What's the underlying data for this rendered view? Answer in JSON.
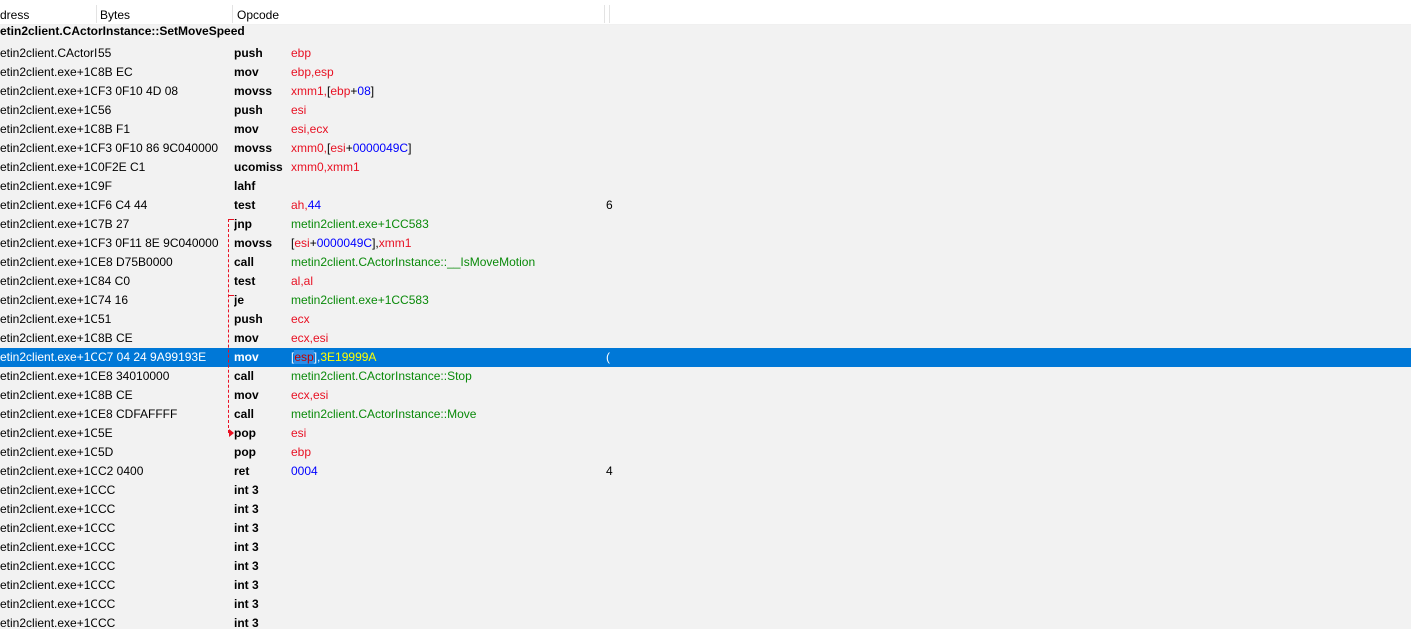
{
  "columns": {
    "address": "dress",
    "bytes": "Bytes",
    "opcode": "Opcode"
  },
  "function_label": "etin2client.CActorInstance::SetMoveSpeed",
  "colors": {
    "selection": "#0078d7",
    "register": "#e81123",
    "number": "#0000ff",
    "symbol": "#0a8a0a",
    "jump_line": "#e81123"
  },
  "rows": [
    {
      "address": "etin2client.CActorIn",
      "bytes": "55",
      "mnemonic": "push",
      "comment": "",
      "operands": [
        {
          "t": "ebp",
          "k": "reg"
        }
      ]
    },
    {
      "address": "etin2client.exe+1C",
      "bytes": "8B EC",
      "mnemonic": "mov",
      "comment": "",
      "operands": [
        {
          "t": "ebp,esp",
          "k": "reg"
        }
      ]
    },
    {
      "address": "etin2client.exe+1C",
      "bytes": "F3 0F10 4D 08",
      "mnemonic": "movss",
      "comment": "",
      "operands": [
        {
          "t": "xmm1,",
          "k": "reg"
        },
        {
          "t": "[",
          "k": "br"
        },
        {
          "t": "ebp",
          "k": "reg"
        },
        {
          "t": "+",
          "k": "br"
        },
        {
          "t": "08",
          "k": "num"
        },
        {
          "t": "]",
          "k": "br"
        }
      ]
    },
    {
      "address": "etin2client.exe+1C",
      "bytes": "56",
      "mnemonic": "push",
      "comment": "",
      "operands": [
        {
          "t": "esi",
          "k": "reg"
        }
      ]
    },
    {
      "address": "etin2client.exe+1C",
      "bytes": "8B F1",
      "mnemonic": "mov",
      "comment": "",
      "operands": [
        {
          "t": "esi,ecx",
          "k": "reg"
        }
      ]
    },
    {
      "address": "etin2client.exe+1C",
      "bytes": "F3 0F10 86 9C040000",
      "mnemonic": "movss",
      "comment": "",
      "operands": [
        {
          "t": "xmm0,",
          "k": "reg"
        },
        {
          "t": "[",
          "k": "br"
        },
        {
          "t": "esi",
          "k": "reg"
        },
        {
          "t": "+",
          "k": "br"
        },
        {
          "t": "0000049C",
          "k": "num"
        },
        {
          "t": "]",
          "k": "br"
        }
      ]
    },
    {
      "address": "etin2client.exe+1C",
      "bytes": "0F2E C1",
      "mnemonic": "ucomiss",
      "comment": "",
      "operands": [
        {
          "t": "xmm0,xmm1",
          "k": "reg"
        }
      ]
    },
    {
      "address": "etin2client.exe+1C",
      "bytes": "9F",
      "mnemonic": "lahf",
      "comment": "",
      "operands": []
    },
    {
      "address": "etin2client.exe+1C",
      "bytes": "F6 C4 44",
      "mnemonic": "test",
      "comment": "6",
      "operands": [
        {
          "t": "ah,",
          "k": "reg"
        },
        {
          "t": "44",
          "k": "num"
        }
      ]
    },
    {
      "address": "etin2client.exe+1C",
      "bytes": "7B 27",
      "mnemonic": "jnp",
      "comment": "",
      "operands": [
        {
          "t": "metin2client.exe+1CC583",
          "k": "addr"
        }
      ]
    },
    {
      "address": "etin2client.exe+1C",
      "bytes": "F3 0F11 8E 9C040000",
      "mnemonic": "movss",
      "comment": "",
      "operands": [
        {
          "t": "[",
          "k": "br"
        },
        {
          "t": "esi",
          "k": "reg"
        },
        {
          "t": "+",
          "k": "br"
        },
        {
          "t": "0000049C",
          "k": "num"
        },
        {
          "t": "],",
          "k": "br"
        },
        {
          "t": "xmm1",
          "k": "reg"
        }
      ]
    },
    {
      "address": "etin2client.exe+1C",
      "bytes": "E8 D75B0000",
      "mnemonic": "call",
      "comment": "",
      "operands": [
        {
          "t": "metin2client.CActorInstance::__IsMoveMotion",
          "k": "addr"
        }
      ]
    },
    {
      "address": "etin2client.exe+1C",
      "bytes": "84 C0",
      "mnemonic": "test",
      "comment": "",
      "operands": [
        {
          "t": "al,al",
          "k": "reg"
        }
      ]
    },
    {
      "address": "etin2client.exe+1C",
      "bytes": "74 16",
      "mnemonic": "je",
      "comment": "",
      "operands": [
        {
          "t": "metin2client.exe+1CC583",
          "k": "addr"
        }
      ]
    },
    {
      "address": "etin2client.exe+1C",
      "bytes": "51",
      "mnemonic": "push",
      "comment": "",
      "operands": [
        {
          "t": "ecx",
          "k": "reg"
        }
      ]
    },
    {
      "address": "etin2client.exe+1C",
      "bytes": "8B CE",
      "mnemonic": "mov",
      "comment": "",
      "operands": [
        {
          "t": "ecx,esi",
          "k": "reg"
        }
      ]
    },
    {
      "address": "etin2client.exe+1C",
      "bytes": "C7 04 24  9A99193E",
      "mnemonic": "mov",
      "comment": "(",
      "selected": true,
      "operands": [
        {
          "t": "[",
          "k": "br"
        },
        {
          "t": "esp",
          "k": "reg",
          "hl": true
        },
        {
          "t": "],",
          "k": "br"
        },
        {
          "t": "3E19999A",
          "k": "num"
        }
      ]
    },
    {
      "address": "etin2client.exe+1C",
      "bytes": "E8 34010000",
      "mnemonic": "call",
      "comment": "",
      "operands": [
        {
          "t": "metin2client.CActorInstance::Stop",
          "k": "addr"
        }
      ]
    },
    {
      "address": "etin2client.exe+1C",
      "bytes": "8B CE",
      "mnemonic": "mov",
      "comment": "",
      "operands": [
        {
          "t": "ecx,esi",
          "k": "reg"
        }
      ]
    },
    {
      "address": "etin2client.exe+1C",
      "bytes": "E8 CDFAFFFF",
      "mnemonic": "call",
      "comment": "",
      "operands": [
        {
          "t": "metin2client.CActorInstance::Move",
          "k": "addr"
        }
      ]
    },
    {
      "address": "etin2client.exe+1C",
      "bytes": "5E",
      "mnemonic": "pop",
      "comment": "",
      "operands": [
        {
          "t": "esi",
          "k": "reg"
        }
      ]
    },
    {
      "address": "etin2client.exe+1C",
      "bytes": "5D",
      "mnemonic": "pop",
      "comment": "",
      "operands": [
        {
          "t": "ebp",
          "k": "reg"
        }
      ]
    },
    {
      "address": "etin2client.exe+1C",
      "bytes": "C2 0400",
      "mnemonic": "ret",
      "comment": "4",
      "operands": [
        {
          "t": "0004",
          "k": "num"
        }
      ]
    },
    {
      "address": "etin2client.exe+1C",
      "bytes": "CC",
      "mnemonic": "int 3",
      "comment": "",
      "operands": []
    },
    {
      "address": "etin2client.exe+1C",
      "bytes": "CC",
      "mnemonic": "int 3",
      "comment": "",
      "operands": []
    },
    {
      "address": "etin2client.exe+1C",
      "bytes": "CC",
      "mnemonic": "int 3",
      "comment": "",
      "operands": []
    },
    {
      "address": "etin2client.exe+1C",
      "bytes": "CC",
      "mnemonic": "int 3",
      "comment": "",
      "operands": []
    },
    {
      "address": "etin2client.exe+1C",
      "bytes": "CC",
      "mnemonic": "int 3",
      "comment": "",
      "operands": []
    },
    {
      "address": "etin2client.exe+1C",
      "bytes": "CC",
      "mnemonic": "int 3",
      "comment": "",
      "operands": []
    },
    {
      "address": "etin2client.exe+1C",
      "bytes": "CC",
      "mnemonic": "int 3",
      "comment": "",
      "operands": []
    },
    {
      "address": "etin2client.exe+1C",
      "bytes": "CC",
      "mnemonic": "int 3",
      "comment": "",
      "operands": []
    }
  ]
}
